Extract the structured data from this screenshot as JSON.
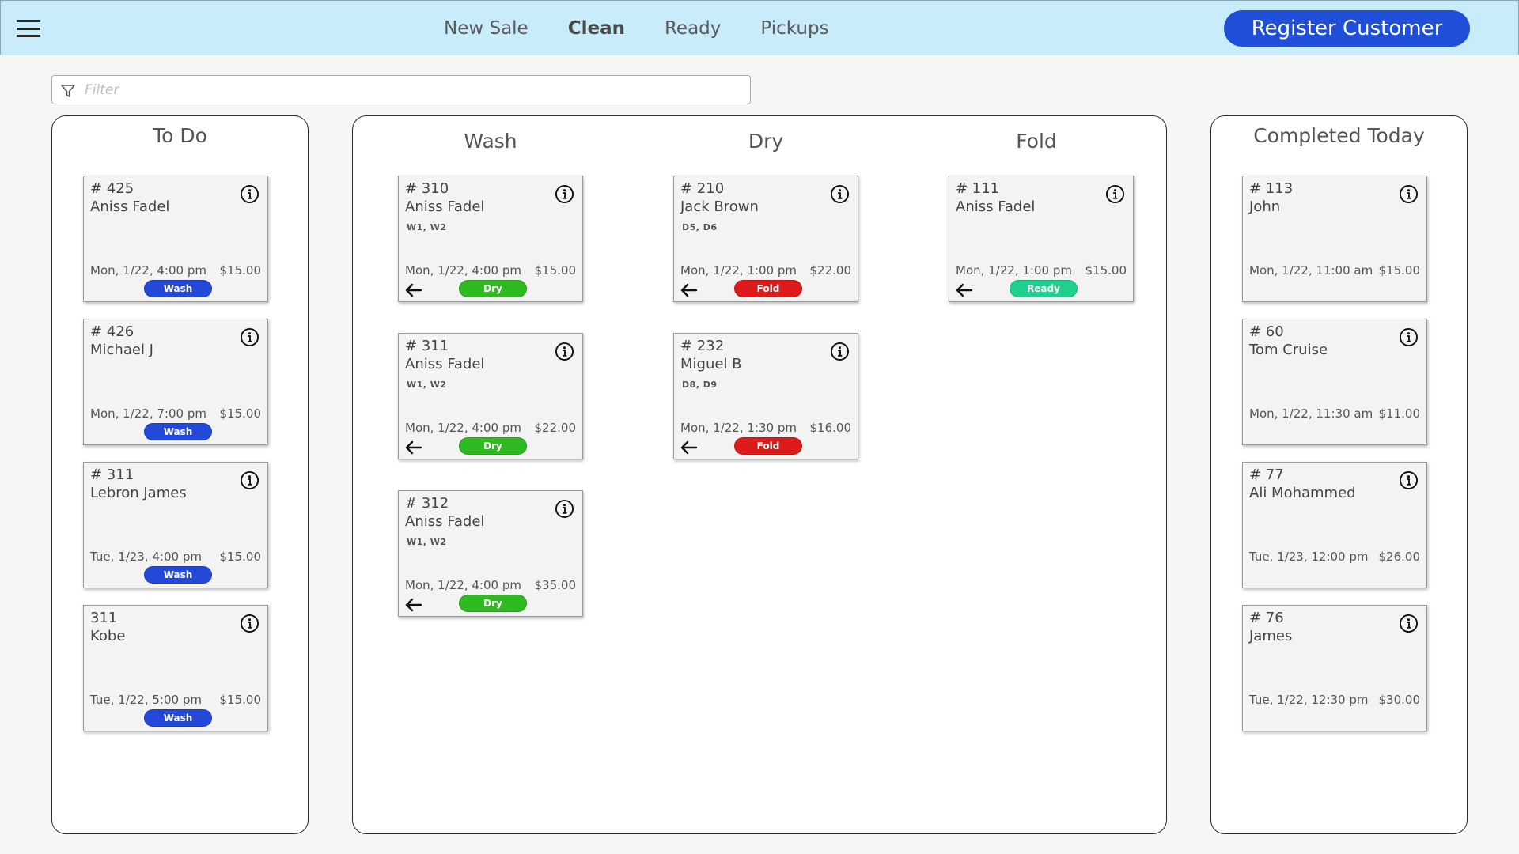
{
  "header": {
    "nav": [
      "New Sale",
      "Clean",
      "Ready",
      "Pickups"
    ],
    "active_nav": "Clean",
    "register_label": "Register Customer"
  },
  "filter": {
    "placeholder": "Filter"
  },
  "columns": {
    "todo": {
      "title": "To Do",
      "cards": [
        {
          "number": "# 425",
          "name": "Aniss Fadel",
          "due": "Mon, 1/22, 4:00 pm",
          "price": "$15.00",
          "status": "Wash"
        },
        {
          "number": "# 426",
          "name": "Michael J",
          "due": "Mon, 1/22, 7:00 pm",
          "price": "$15.00",
          "status": "Wash"
        },
        {
          "number": "# 311",
          "name": "Lebron James",
          "due": "Tue, 1/23, 4:00 pm",
          "price": "$15.00",
          "status": "Wash"
        },
        {
          "number": "311",
          "name": "Kobe",
          "due": "Tue, 1/22, 5:00 pm",
          "price": "$15.00",
          "status": "Wash"
        }
      ]
    },
    "wash": {
      "title": "Wash",
      "cards": [
        {
          "number": "# 310",
          "name": "Aniss Fadel",
          "items": "W1, W2",
          "due": "Mon, 1/22, 4:00 pm",
          "price": "$15.00",
          "status": "Dry"
        },
        {
          "number": "# 311",
          "name": "Aniss Fadel",
          "items": "W1, W2",
          "due": "Mon, 1/22, 4:00 pm",
          "price": "$22.00",
          "status": "Dry"
        },
        {
          "number": "# 312",
          "name": "Aniss Fadel",
          "items": "W1, W2",
          "due": "Mon, 1/22, 4:00 pm",
          "price": "$35.00",
          "status": "Dry"
        }
      ]
    },
    "dry": {
      "title": "Dry",
      "cards": [
        {
          "number": "# 210",
          "name": "Jack Brown",
          "items": "D5, D6",
          "due": "Mon, 1/22, 1:00 pm",
          "price": "$22.00",
          "status": "Fold"
        },
        {
          "number": "# 232",
          "name": "Miguel B",
          "items": "D8, D9",
          "due": "Mon, 1/22, 1:30 pm",
          "price": "$16.00",
          "status": "Fold"
        }
      ]
    },
    "fold": {
      "title": "Fold",
      "cards": [
        {
          "number": "# 111",
          "name": "Aniss Fadel",
          "due": "Mon, 1/22, 1:00 pm",
          "price": "$15.00",
          "status": "Ready"
        }
      ]
    },
    "completed": {
      "title": "Completed Today",
      "cards": [
        {
          "number": "# 113",
          "name": "John",
          "due": "Mon, 1/22, 11:00 am",
          "price": "$15.00"
        },
        {
          "number": "# 60",
          "name": "Tom Cruise",
          "due": "Mon, 1/22, 11:30 am",
          "price": "$11.00"
        },
        {
          "number": "# 77",
          "name": "Ali Mohammed",
          "due": "Tue, 1/23, 12:00 pm",
          "price": "$26.00"
        },
        {
          "number": "# 76",
          "name": "James",
          "due": "Tue, 1/22, 12:30 pm",
          "price": "$30.00"
        }
      ]
    }
  },
  "colors": {
    "header_bg": "#c9ecfb",
    "primary": "#1f4fd8",
    "wash": "#2448d8",
    "dry": "#2fba22",
    "fold": "#dd1b1b",
    "ready": "#1dd08b"
  },
  "icons": [
    "menu-icon",
    "filter-icon",
    "info-icon",
    "arrow-left-icon"
  ]
}
